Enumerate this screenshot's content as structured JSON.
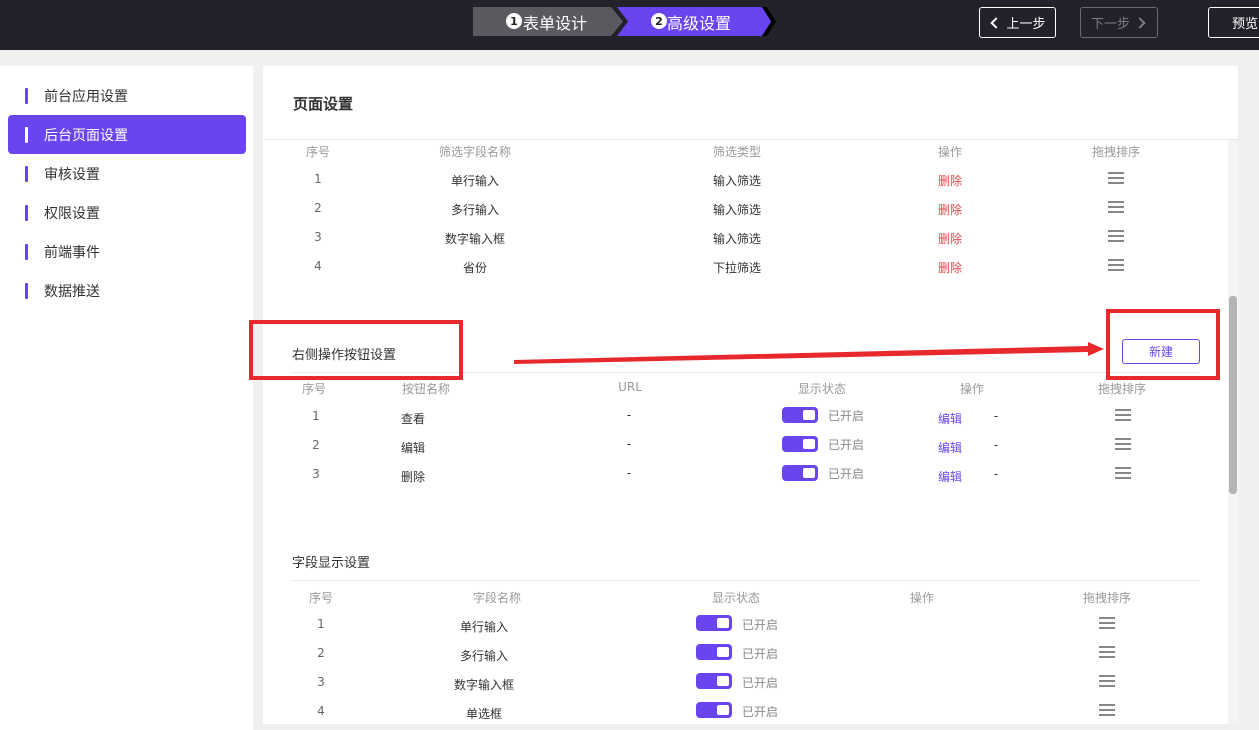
{
  "topbar": {
    "steps": [
      {
        "num": "1",
        "label": "表单设计"
      },
      {
        "num": "2",
        "label": "高级设置"
      }
    ],
    "prev_label": "上一步",
    "next_label": "下一步",
    "preview_label": "预览"
  },
  "sidebar": {
    "items": [
      {
        "label": "前台应用设置"
      },
      {
        "label": "后台页面设置"
      },
      {
        "label": "审核设置"
      },
      {
        "label": "权限设置"
      },
      {
        "label": "前端事件"
      },
      {
        "label": "数据推送"
      }
    ],
    "active_index": 1
  },
  "main": {
    "title": "页面设置",
    "filter_table": {
      "headers": [
        "序号",
        "筛选字段名称",
        "筛选类型",
        "操作",
        "拖拽排序"
      ],
      "rows": [
        {
          "num": "1",
          "name": "单行输入",
          "type": "输入筛选",
          "action": "删除"
        },
        {
          "num": "2",
          "name": "多行输入",
          "type": "输入筛选",
          "action": "删除"
        },
        {
          "num": "3",
          "name": "数字输入框",
          "type": "输入筛选",
          "action": "删除"
        },
        {
          "num": "4",
          "name": "省份",
          "type": "下拉筛选",
          "action": "删除"
        }
      ]
    },
    "button_section": {
      "title": "右侧操作按钮设置",
      "new_label": "新建",
      "headers": [
        "序号",
        "按钮名称",
        "URL",
        "显示状态",
        "操作",
        "拖拽排序"
      ],
      "rows": [
        {
          "num": "1",
          "name": "查看",
          "url": "-",
          "status": "已开启",
          "edit": "编辑",
          "extra": "-"
        },
        {
          "num": "2",
          "name": "编辑",
          "url": "-",
          "status": "已开启",
          "edit": "编辑",
          "extra": "-"
        },
        {
          "num": "3",
          "name": "删除",
          "url": "-",
          "status": "已开启",
          "edit": "编辑",
          "extra": "-"
        }
      ]
    },
    "field_section": {
      "title": "字段显示设置",
      "headers": [
        "序号",
        "字段名称",
        "显示状态",
        "操作",
        "拖拽排序"
      ],
      "rows": [
        {
          "num": "1",
          "name": "单行输入",
          "status": "已开启"
        },
        {
          "num": "2",
          "name": "多行输入",
          "status": "已开启"
        },
        {
          "num": "3",
          "name": "数字输入框",
          "status": "已开启"
        },
        {
          "num": "4",
          "name": "单选框",
          "status": "已开启"
        }
      ]
    }
  },
  "colors": {
    "accent": "#6a45ef",
    "topbar": "#23222a",
    "danger": "#e5484d",
    "annotation": "#e7282d"
  }
}
